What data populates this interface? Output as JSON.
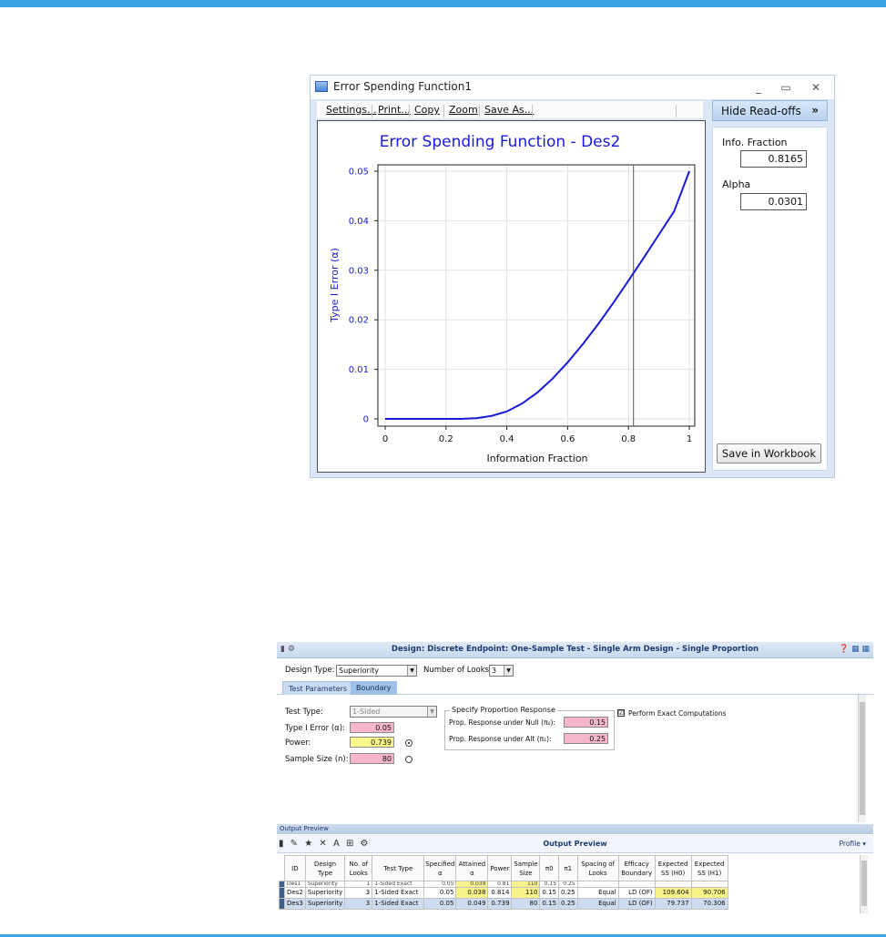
{
  "error_spending_window": {
    "title": "Error Spending Function1",
    "toolbar": [
      "Settings...",
      "Print...",
      "Copy",
      "Zoom",
      "Save As..."
    ],
    "hide_readoffs_label": "Hide Read-offs",
    "hide_readoffs_arrow": "»",
    "info_fraction_label": "Info. Fraction",
    "info_fraction_value": "0.8165",
    "alpha_label": "Alpha",
    "alpha_value": "0.0301",
    "save_in_workbook_label": "Save in Workbook",
    "window_controls": [
      "_",
      "▭",
      "✕"
    ]
  },
  "chart_data": {
    "type": "line",
    "title": "Error Spending Function - Des2",
    "xlabel": "Information Fraction",
    "ylabel": "Type I Error (α)",
    "xlim": [
      0,
      1
    ],
    "ylim": [
      0,
      0.05
    ],
    "x_ticks": [
      "0",
      "0.2",
      "0.4",
      "0.6",
      "0.8",
      "1"
    ],
    "y_ticks": [
      "0",
      "0.01",
      "0.02",
      "0.03",
      "0.04",
      "0.05"
    ],
    "grid": true,
    "line_color": "#1a1ad6",
    "readoff_x": 0.8165,
    "series": [
      {
        "x": [
          0,
          0.1,
          0.2,
          0.25,
          0.3,
          0.35,
          0.4,
          0.45,
          0.5,
          0.55,
          0.6,
          0.65,
          0.7,
          0.75,
          0.8,
          0.85,
          0.9,
          0.95,
          1.0
        ],
        "values": [
          0,
          0,
          0,
          1e-05,
          0.00013,
          0.0006,
          0.0015,
          0.0031,
          0.0053,
          0.0081,
          0.0114,
          0.0151,
          0.0191,
          0.0234,
          0.0279,
          0.0325,
          0.0372,
          0.0419,
          0.05
        ]
      }
    ]
  },
  "design_window": {
    "title": "Design: Discrete Endpoint: One-Sample Test - Single Arm Design - Single Proportion",
    "design_type_label": "Design Type:",
    "design_type_value": "Superiority",
    "looks_label": "Number of Looks:",
    "looks_value": "3",
    "tabs": [
      "Test Parameters",
      "Boundary"
    ],
    "test_type_label": "Test Type:",
    "test_type_value": "1-Sided",
    "type1_label": "Type I Error (α):",
    "type1_value": "0.05",
    "power_label": "Power:",
    "power_value": "0.739",
    "sample_size_label": "Sample Size (n):",
    "sample_size_value": "80",
    "group_title": "Specify Proportion Response",
    "null_label": "Prop.  Response under Null (π₀):",
    "null_value": "0.15",
    "alt_label": "Prop.  Response under Alt (π₁):",
    "alt_value": "0.25",
    "exact_label": "Perform Exact Computations",
    "exact_checked": "☑"
  },
  "output_preview": {
    "header": "Output Preview",
    "title": "Output Preview",
    "profile_label": "Profile ▾",
    "columns": [
      "ID",
      "Design Type",
      "No. of Looks",
      "Test Type",
      "Specified α",
      "Attained α",
      "Power",
      "Sample Size",
      "π0",
      "π1",
      "Spacing of Looks",
      "Efficacy Boundary",
      "Expected SS (H0)",
      "Expected SS (H1)"
    ],
    "rows": [
      [
        "Des1",
        "Superiority",
        "1",
        "1-Sided Exact",
        "0.05",
        "0.039",
        "0.81",
        "110",
        "0.15",
        "0.25",
        "",
        "",
        "",
        ""
      ],
      [
        "Des2",
        "Superiority",
        "3",
        "1-Sided Exact",
        "0.05",
        "0.038",
        "0.814",
        "110",
        "0.15",
        "0.25",
        "Equal",
        "LD (OF)",
        "109.604",
        "90.706"
      ],
      [
        "Des3",
        "Superiority",
        "3",
        "1-Sided Exact",
        "0.05",
        "0.049",
        "0.739",
        "80",
        "0.15",
        "0.25",
        "Equal",
        "LD (OF)",
        "79.737",
        "70.306"
      ]
    ]
  }
}
